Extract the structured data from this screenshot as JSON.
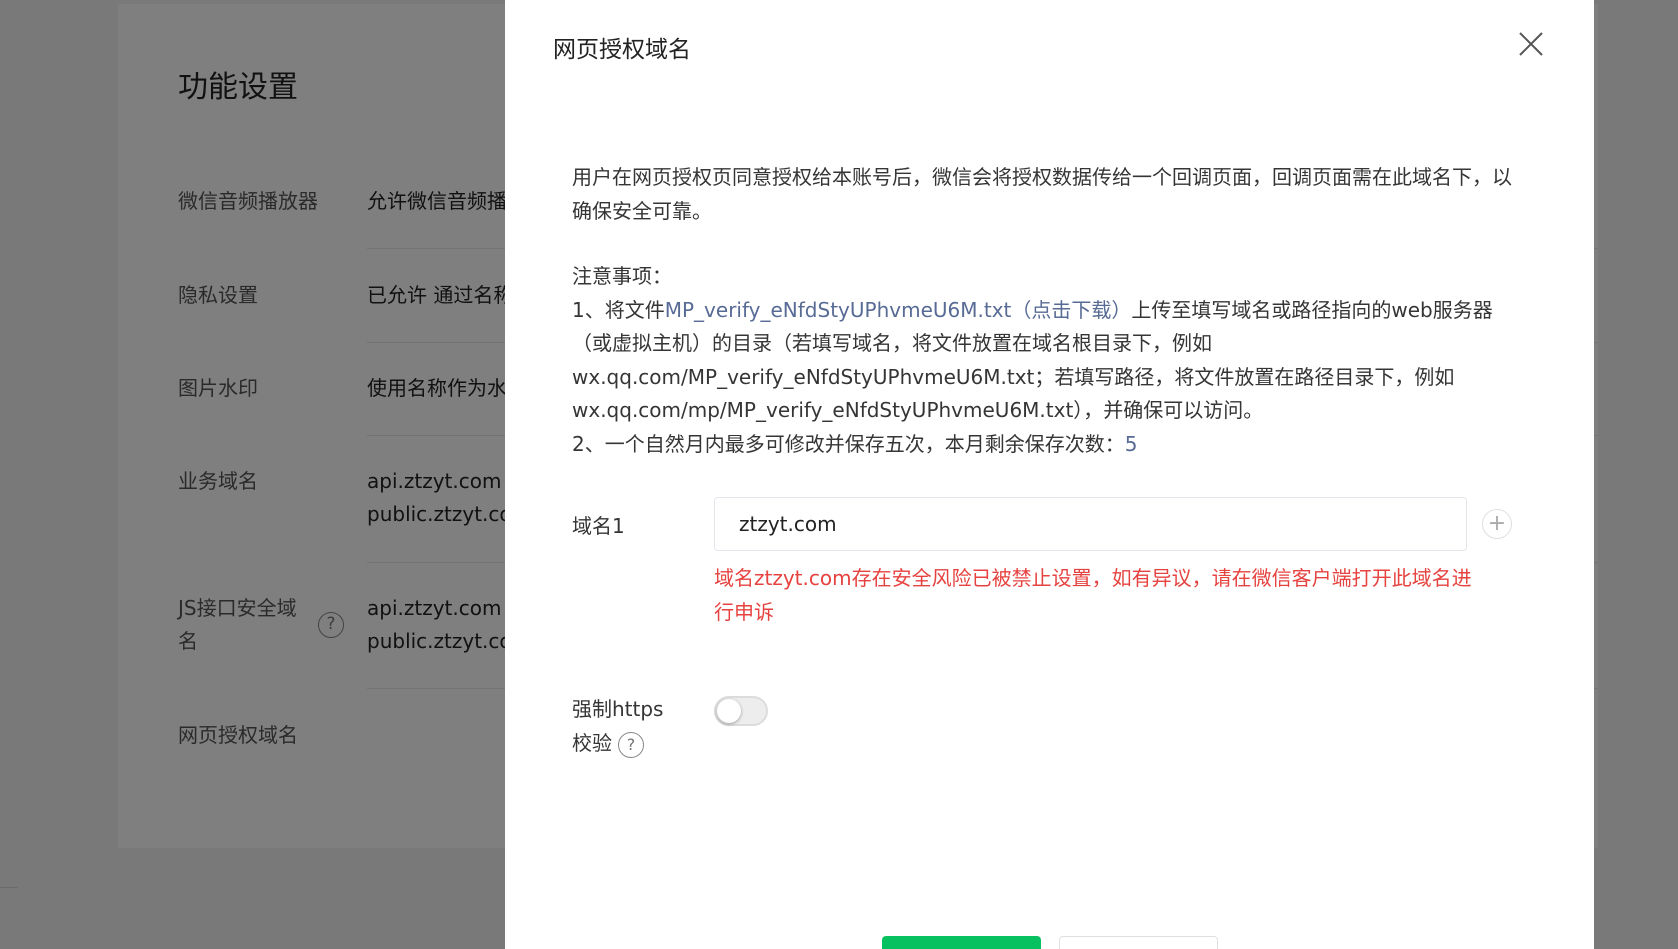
{
  "background": {
    "title": "功能设置",
    "rows": [
      {
        "label": "微信音频播放器",
        "value": "允许微信音频播放器"
      },
      {
        "label": "隐私设置",
        "value": "已允许 通过名称"
      },
      {
        "label": "图片水印",
        "value": "使用名称作为水印"
      },
      {
        "label": "业务域名",
        "value": "api.ztzyt.com",
        "value2": "public.ztzyt.com"
      },
      {
        "label_line1": "JS接口安全域",
        "label_line2": "名",
        "help": "?",
        "value": "api.ztzyt.com",
        "value2": "public.ztzyt.com"
      },
      {
        "label": "网页授权域名"
      }
    ]
  },
  "dialog": {
    "title": "网页授权域名",
    "close_icon": "close-icon",
    "description": "用户在网页授权页同意授权给本账号后，微信会将授权数据传给一个回调页面，回调页面需在此域名下，以确保安全可靠。",
    "notes_title": "注意事项：",
    "note1_prefix": "1、将文件",
    "note1_link": "MP_verify_eNfdStyUPhvmeU6M.txt（点击下载）",
    "note1_suffix": "上传至填写域名或路径指向的web服务器（或虚拟主机）的目录（若填写域名，将文件放置在域名根目录下，例如wx.qq.com/MP_verify_eNfdStyUPhvmeU6M.txt；若填写路径，将文件放置在路径目录下，例如wx.qq.com/mp/MP_verify_eNfdStyUPhvmeU6M.txt），并确保可以访问。",
    "note2_prefix": "2、一个自然月内最多可修改并保存五次，本月剩余保存次数：",
    "note2_count": "5",
    "domain_label": "域名1",
    "domain_value": "ztzyt.com",
    "add_icon": "plus-icon",
    "add_symbol": "+",
    "error": "域名ztzyt.com存在安全风险已被禁止设置，如有异议，请在微信客户端打开此域名进行申诉",
    "https_label": "强制https校验",
    "https_help": "?",
    "https_enabled": false
  },
  "colors": {
    "accent_link": "#576b95",
    "error": "#e64340",
    "primary_button": "#07c160"
  }
}
